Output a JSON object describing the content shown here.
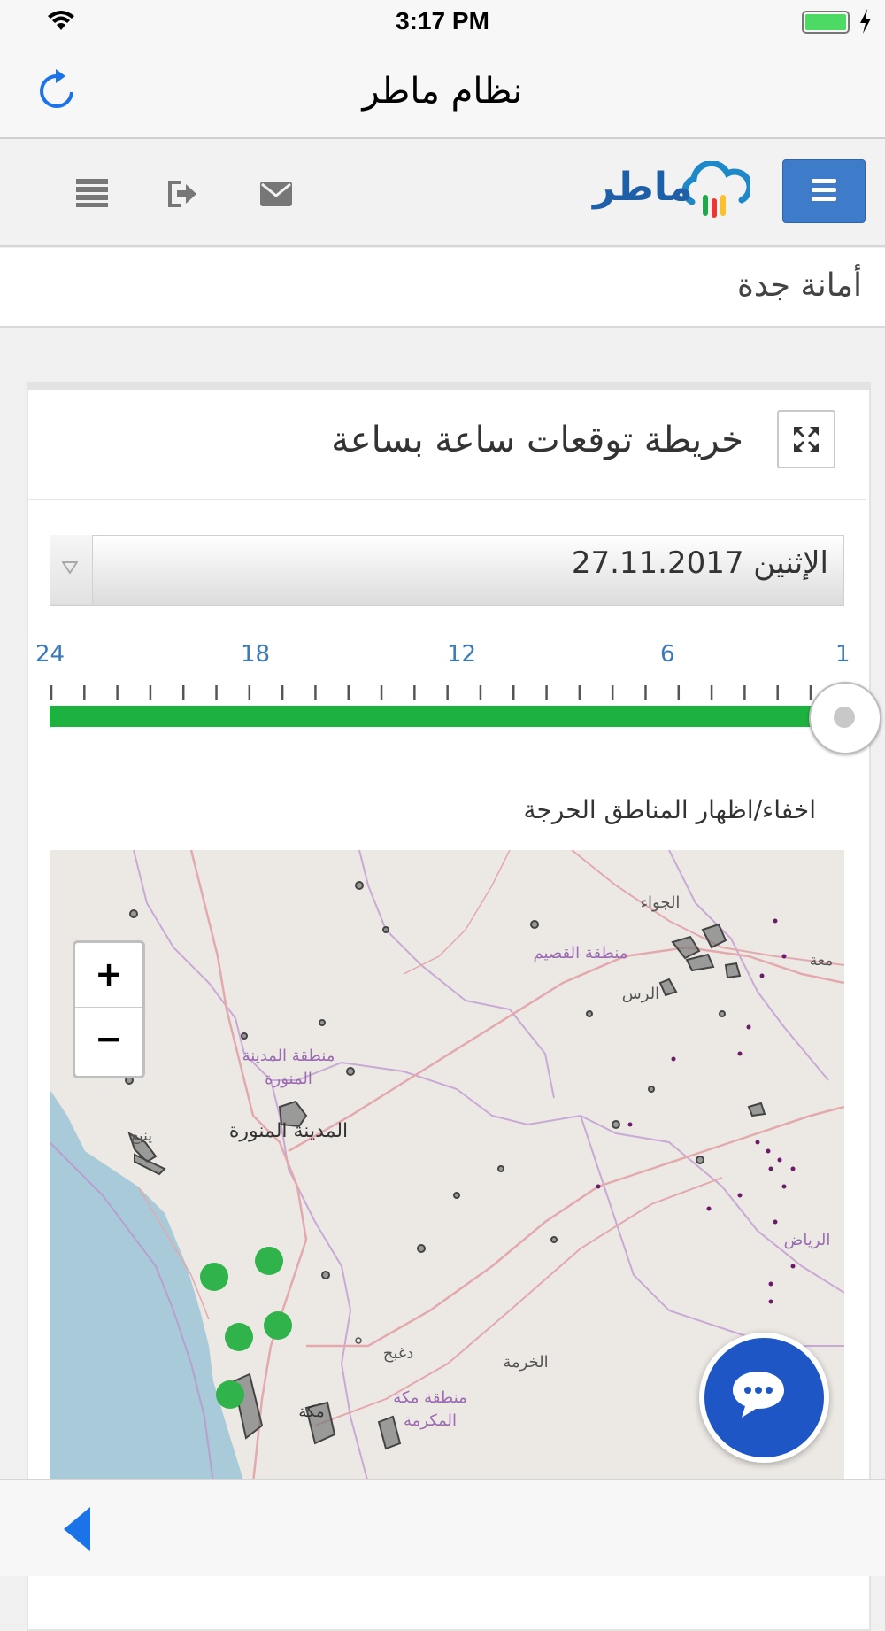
{
  "status_bar": {
    "time": "3:17 PM",
    "wifi_icon": "wifi-icon",
    "battery_icon": "battery-charging-icon"
  },
  "nav": {
    "title": "نظام ماطر",
    "refresh_icon": "refresh-icon"
  },
  "header": {
    "logo_text": "ماطر",
    "menu_icon": "hamburger-menu-icon",
    "icons": [
      "list-icon",
      "sign-out-icon",
      "envelope-icon"
    ]
  },
  "org": {
    "name": "أمانة جدة"
  },
  "panel": {
    "title": "خريطة توقعات ساعة بساعة",
    "expand_icon": "expand-icon",
    "date_value": "الإثنين 27.11.2017",
    "slider": {
      "labels": [
        "24",
        "18",
        "12",
        "6",
        "1"
      ],
      "value": 1,
      "min": 1,
      "max": 24
    },
    "toggle_label": "اخفاء/اظهار المناطق الحرجة"
  },
  "map": {
    "zoom_in": "+",
    "zoom_out": "−",
    "labels": {
      "jawf": "الجواء",
      "qassim": "منطقة القصيم",
      "rass": "الرس",
      "madinah_region_1": "منطقة المدينة",
      "madinah_region_2": "المنورة",
      "madinah_city": "المدينة المنورة",
      "yanbu": "ينبع",
      "riyadh": "الرياض",
      "daghbaj": "دغبج",
      "khurmah": "الخرمة",
      "makkah_region_1": "منطقة مكة",
      "makkah_region_2": "المكرمة",
      "makkah": "مكة",
      "majmaah": "معة"
    },
    "colors": {
      "sea": "#a9cad8",
      "land": "#ece9e4",
      "road": "#e3a9ad",
      "border": "#c9a9d6",
      "station": "#2fb34a",
      "zone": "#555555"
    }
  },
  "chat_icon": "chat-bubble-icon",
  "bottom": {
    "back_icon": "back-arrow-icon"
  }
}
